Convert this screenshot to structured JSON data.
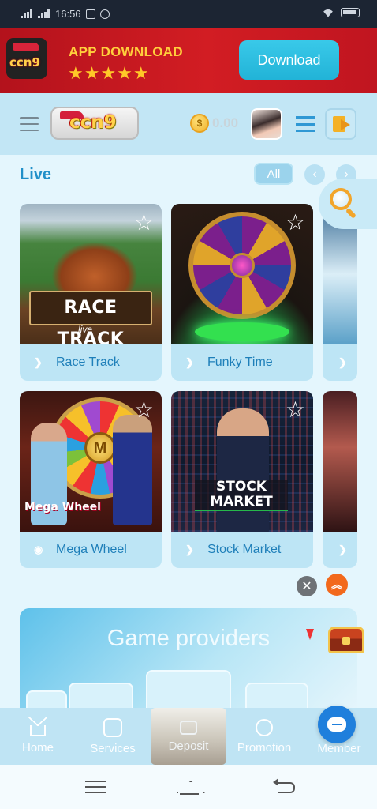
{
  "status_bar": {
    "time": "16:56"
  },
  "banner": {
    "title": "APP DOWNLOAD",
    "stars": "★★★★★",
    "download_label": "Download",
    "logo_text": "ccn9"
  },
  "header": {
    "logo_text": "ccn9",
    "coin_symbol": "$",
    "balance": "0.00"
  },
  "live": {
    "title": "Live",
    "all_label": "All",
    "prev": "‹",
    "next": "›",
    "games": [
      {
        "name": "Race Track",
        "art_text": "RACE TRACK",
        "art_sub": "live"
      },
      {
        "name": "Funky Time"
      },
      {
        "name": "Mega Wheel",
        "art_text": "Mega Wheel",
        "hub": "M"
      },
      {
        "name": "Stock Market",
        "art_text": "STOCK MARKET"
      }
    ],
    "star_glyph": "☆",
    "chevron": "❯"
  },
  "floating": {
    "close": "✕",
    "scroll_top": "︽"
  },
  "providers": {
    "title": "Game providers"
  },
  "bottom_nav": {
    "home": "Home",
    "services": "Services",
    "deposit": "Deposit",
    "promotion": "Promotion",
    "member": "Member"
  },
  "colors": {
    "banner_red": "#d21d23",
    "accent_blue": "#2190c9",
    "download_cyan": "#22b3d7",
    "scroll_orange": "#f2691c",
    "chat_blue": "#1f7fdc"
  }
}
